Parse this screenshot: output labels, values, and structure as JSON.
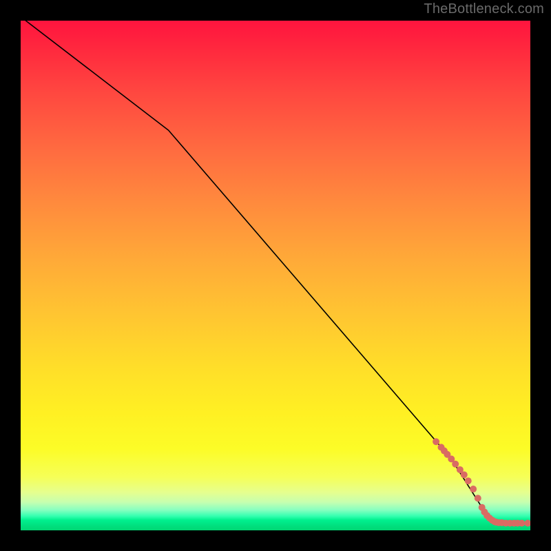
{
  "watermark_text": "TheBottleneck.com",
  "chart_data": {
    "type": "line",
    "title": "",
    "xlabel": "",
    "ylabel": "",
    "xlim": [
      0,
      100
    ],
    "ylim": [
      0,
      100
    ],
    "axes_visible": false,
    "grid": false,
    "background": "gradient-red-yellow-green-vertical",
    "series": [
      {
        "name": "curve",
        "stroke": "#000000",
        "points": [
          {
            "x": 1.0,
            "y": 100.0
          },
          {
            "x": 29.0,
            "y": 78.5
          },
          {
            "x": 84.5,
            "y": 14.0
          },
          {
            "x": 90.5,
            "y": 4.5
          },
          {
            "x": 92.5,
            "y": 2.2
          },
          {
            "x": 94.0,
            "y": 1.5
          },
          {
            "x": 100.0,
            "y": 1.4
          }
        ]
      }
    ],
    "markers": {
      "name": "points",
      "color": "#d96b63",
      "radius": 5,
      "data": [
        {
          "x": 81.5,
          "y": 17.4
        },
        {
          "x": 82.5,
          "y": 16.3
        },
        {
          "x": 83.1,
          "y": 15.6
        },
        {
          "x": 83.7,
          "y": 14.9
        },
        {
          "x": 84.5,
          "y": 14.0
        },
        {
          "x": 85.3,
          "y": 13.0
        },
        {
          "x": 86.2,
          "y": 11.9
        },
        {
          "x": 87.0,
          "y": 10.9
        },
        {
          "x": 87.8,
          "y": 9.7
        },
        {
          "x": 88.8,
          "y": 8.1
        },
        {
          "x": 89.7,
          "y": 6.3
        },
        {
          "x": 90.5,
          "y": 4.5
        },
        {
          "x": 91.0,
          "y": 3.6
        },
        {
          "x": 91.5,
          "y": 2.9
        },
        {
          "x": 92.0,
          "y": 2.4
        },
        {
          "x": 92.5,
          "y": 2.0
        },
        {
          "x": 93.0,
          "y": 1.7
        },
        {
          "x": 93.3,
          "y": 1.6
        },
        {
          "x": 93.8,
          "y": 1.5
        },
        {
          "x": 94.4,
          "y": 1.5
        },
        {
          "x": 95.2,
          "y": 1.4
        },
        {
          "x": 96.0,
          "y": 1.4
        },
        {
          "x": 96.8,
          "y": 1.4
        },
        {
          "x": 97.5,
          "y": 1.4
        },
        {
          "x": 98.3,
          "y": 1.4
        },
        {
          "x": 99.5,
          "y": 1.4
        }
      ]
    }
  }
}
